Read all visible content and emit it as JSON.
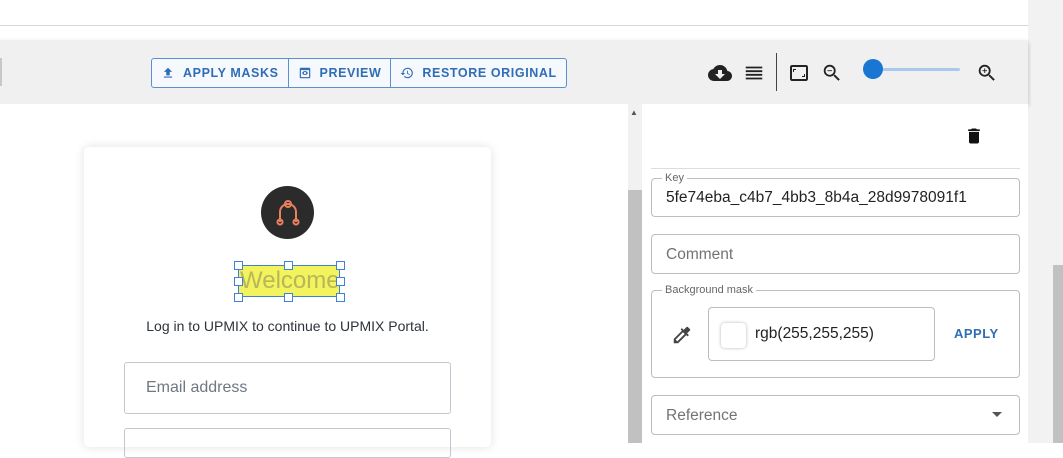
{
  "toolbar": {
    "apply_masks_label": "APPLY MASKS",
    "preview_label": "PREVIEW",
    "restore_label": "RESTORE ORIGINAL",
    "icons": [
      "upload-icon",
      "preview-icon",
      "history-icon",
      "cloud-download-icon",
      "menu-icon",
      "fit-screen-icon",
      "zoom-out-icon",
      "zoom-in-icon"
    ],
    "zoom_level": 0.05,
    "accent_color": "#1976d2"
  },
  "canvas": {
    "welcome_text": "Welcome",
    "login_subtitle": "Log in to UPMIX to continue to UPMIX Portal.",
    "email_placeholder": "Email address",
    "highlight_color": "#f3f35d"
  },
  "panel": {
    "key_label": "Key",
    "key_value": "5fe74eba_c4b7_4bb3_8b4a_28d9978091f1",
    "comment_placeholder": "Comment",
    "background_mask_label": "Background mask",
    "background_mask_value": "rgb(255,255,255)",
    "apply_label": "APPLY",
    "reference_placeholder": "Reference"
  }
}
